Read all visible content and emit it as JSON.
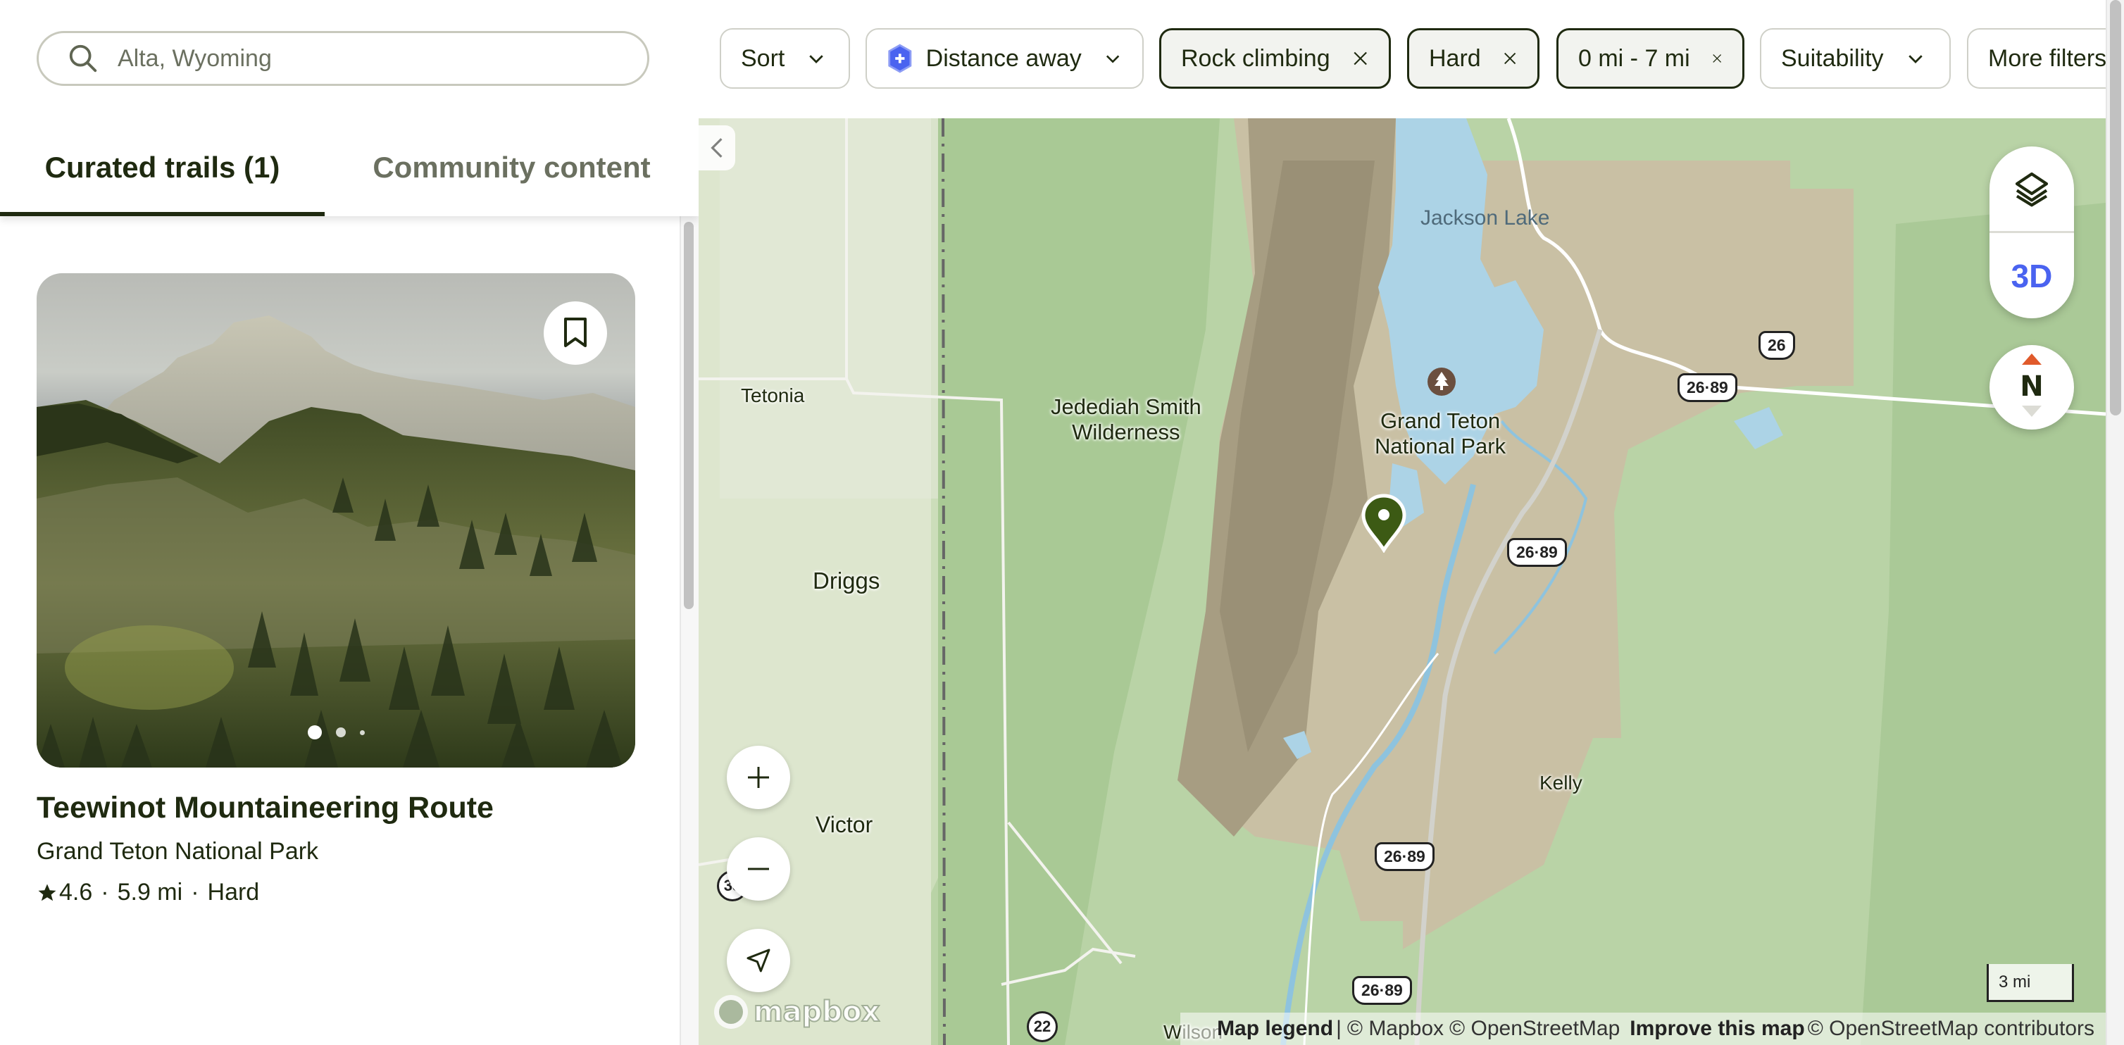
{
  "search": {
    "placeholder": "Alta, Wyoming",
    "icon": "search-icon"
  },
  "filters": [
    {
      "label": "Sort",
      "type": "dropdown",
      "active": false
    },
    {
      "label": "Distance away",
      "type": "dropdown",
      "active": false,
      "icon": "shield-plus-icon"
    },
    {
      "label": "Rock climbing",
      "type": "removable",
      "active": true
    },
    {
      "label": "Hard",
      "type": "removable",
      "active": true
    },
    {
      "label": "0 mi - 7 mi",
      "type": "removable",
      "active": true
    },
    {
      "label": "Suitability",
      "type": "dropdown",
      "active": false
    },
    {
      "label": "More filters",
      "type": "button",
      "active": false
    }
  ],
  "tabs": [
    {
      "label": "Curated trails (1)",
      "selected": true
    },
    {
      "label": "Community content",
      "selected": false
    }
  ],
  "trail_card": {
    "title": "Teewinot Mountaineering Route",
    "location": "Grand Teton National Park",
    "rating": "4.6",
    "distance": "5.9 mi",
    "difficulty": "Hard",
    "separator": "·",
    "image_count": 3,
    "active_image": 1
  },
  "map": {
    "labels": {
      "jackson_lake": "Jackson Lake",
      "tetonia": "Tetonia",
      "jedediah": "Jedediah Smith\nWilderness",
      "grand_teton": "Grand Teton\nNational Park",
      "driggs": "Driggs",
      "victor": "Victor",
      "kelly": "Kelly",
      "wilson": "Wilson"
    },
    "route_shields": [
      "26",
      "26·89",
      "26·89",
      "26·89",
      "26·89",
      "22",
      "33"
    ],
    "controls": {
      "three_d": "3D",
      "compass": "N"
    },
    "scale": "3 mi",
    "logo": "mapbox",
    "attribution": {
      "legend": "Map legend",
      "sep": "|",
      "mapbox": "© Mapbox",
      "osm": "© OpenStreetMap",
      "improve": "Improve this map",
      "contributors": "© OpenStreetMap contributors"
    },
    "colors": {
      "park": "#c9c2a8",
      "forest": "#b9d6a6",
      "valley": "#e6ebdc",
      "water": "#acd3e6",
      "pin": "#3c5a14",
      "accent_3d": "#4a63f0",
      "compass_north": "#e05a2b"
    }
  },
  "colors": {
    "text_primary": "#1f2a10",
    "text_secondary": "#6b7060",
    "active_chip_bg": "#f2f3ef",
    "chip_border": "#cfd0c8"
  }
}
